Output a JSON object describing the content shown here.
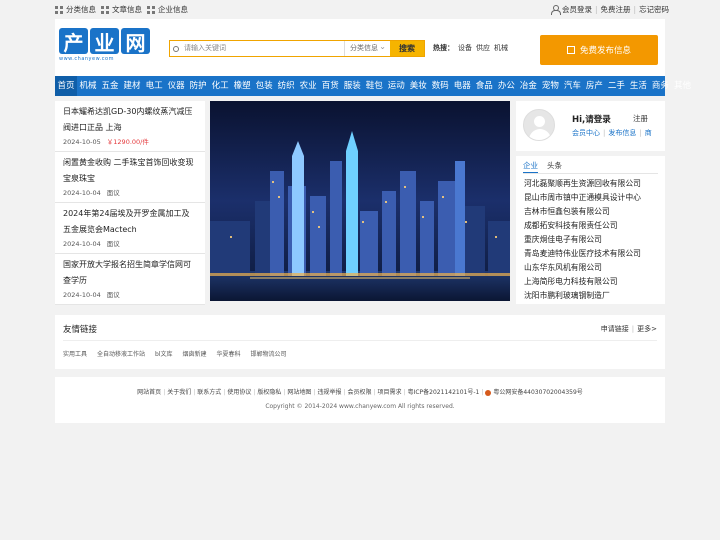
{
  "topbar": {
    "left": [
      "分类信息",
      "文章信息",
      "企业信息"
    ],
    "member_login": "会员登录",
    "free_register": "免费注册",
    "forgot_password": "忘记密码"
  },
  "logo": {
    "chars": [
      "产",
      "业",
      "网"
    ],
    "url": "www.chanyew.com"
  },
  "search": {
    "placeholder": "请输入关键词",
    "category": "分类信息",
    "button": "搜索"
  },
  "hot": {
    "label": "热搜：",
    "terms": [
      "设备",
      "供应",
      "机械"
    ]
  },
  "publish_button": "免费发布信息",
  "nav": [
    "首页",
    "机械",
    "五金",
    "建材",
    "电工",
    "仪器",
    "防护",
    "化工",
    "橡塑",
    "包装",
    "纺织",
    "农业",
    "百货",
    "服装",
    "鞋包",
    "运动",
    "美妆",
    "数码",
    "电器",
    "食品",
    "办公",
    "冶金",
    "宠物",
    "汽车",
    "房产",
    "二手",
    "生活",
    "商务",
    "其他"
  ],
  "news": [
    {
      "title": "日本耀希达凯GD-30内螺纹蒸汽减压阀进口正品 上海",
      "date": "2024-10-05",
      "extra": "￥1290.00/件",
      "extra_type": "price"
    },
    {
      "title": "闲置黄金收购 二手珠宝首饰回收变现 宝泉珠宝",
      "date": "2024-10-04",
      "extra": "面议",
      "extra_type": "loc"
    },
    {
      "title": "2024年第24届埃及开罗金属加工及五金展览会Mactech",
      "date": "2024-10-04",
      "extra": "面议",
      "extra_type": "loc"
    },
    {
      "title": "国家开放大学报名招生简章学信网可查学历",
      "date": "2024-10-04",
      "extra": "面议",
      "extra_type": "loc"
    }
  ],
  "user": {
    "greeting": "Hi,请登录",
    "register": "注册",
    "member_center": "会员中心",
    "publish_info": "发布信息",
    "shop": "商"
  },
  "company_tabs": [
    "企业",
    "头条"
  ],
  "companies": [
    "河北磊聚顺再生资源回收有限公司",
    "昆山市周市镇中正通模具设计中心",
    "吉林市恒鑫包装有限公司",
    "成都拓安科技有限责任公司",
    "重庆烔佳电子有限公司",
    "青岛麦迪特伟业医疗技术有限公司",
    "山东华东风机有限公司",
    "上海简彤电力科技有限公司",
    "沈阳市鹏利玻璃钢制造厂"
  ],
  "friends": {
    "title": "友情链接",
    "apply": "申请链接",
    "more": "更多>",
    "links": [
      "实用工具",
      "全自动移液工作站",
      "bl文库",
      "烟囱新建",
      "华夏春科",
      "邯郸物流公司"
    ]
  },
  "footer": {
    "links": [
      "网站首页",
      "关于我们",
      "联系方式",
      "使用协议",
      "版权隐私",
      "网站地图",
      "违规举报",
      "会员权限",
      "项目需求",
      "粤ICP备2021142101号-1",
      "粤公网安备44030702004359号"
    ],
    "copyright": "Copyright © 2014-2024 www.chanyew.com All rights reserved."
  },
  "colors": {
    "brand": "#1a73c8",
    "accent": "#f39800",
    "price": "#e4393c"
  }
}
